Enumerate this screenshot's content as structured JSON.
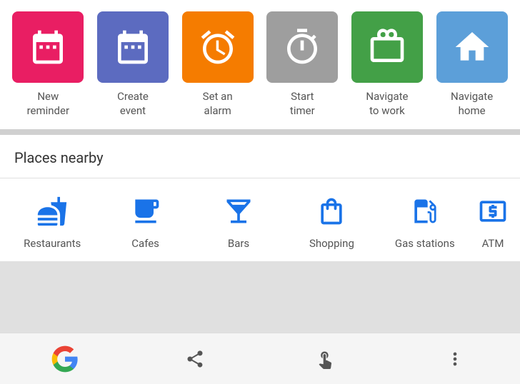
{
  "quick_actions": {
    "items": [
      {
        "id": "new-reminder",
        "label": "New\nreminder",
        "label_line1": "New",
        "label_line2": "reminder",
        "bg": "bg-pink",
        "icon": "reminder"
      },
      {
        "id": "create-event",
        "label": "Create\nevent",
        "label_line1": "Create",
        "label_line2": "event",
        "bg": "bg-purple",
        "icon": "calendar"
      },
      {
        "id": "set-alarm",
        "label": "Set an\nalarm",
        "label_line1": "Set an",
        "label_line2": "alarm",
        "bg": "bg-orange",
        "icon": "alarm"
      },
      {
        "id": "start-timer",
        "label": "Start\ntimer",
        "label_line1": "Start",
        "label_line2": "timer",
        "bg": "bg-gray",
        "icon": "timer"
      },
      {
        "id": "navigate-work",
        "label": "Navigate\nto work",
        "label_line1": "Navigate",
        "label_line2": "to work",
        "bg": "bg-green",
        "icon": "work"
      },
      {
        "id": "navigate-home",
        "label": "Navigate\nhome",
        "label_line1": "Navigate",
        "label_line2": "home",
        "bg": "bg-blue",
        "icon": "home"
      }
    ]
  },
  "places_nearby": {
    "title": "Places nearby",
    "items": [
      {
        "id": "restaurants",
        "label": "Restaurants",
        "icon": "cutlery"
      },
      {
        "id": "cafes",
        "label": "Cafes",
        "icon": "coffee"
      },
      {
        "id": "bars",
        "label": "Bars",
        "icon": "cocktail"
      },
      {
        "id": "shopping",
        "label": "Shopping",
        "icon": "shopping"
      },
      {
        "id": "gas-stations",
        "label": "Gas stations",
        "icon": "gas"
      },
      {
        "id": "atm",
        "label": "ATM",
        "icon": "atm"
      }
    ]
  },
  "bottom_nav": {
    "items": [
      {
        "id": "google",
        "icon": "google-g"
      },
      {
        "id": "share",
        "icon": "share"
      },
      {
        "id": "touch",
        "icon": "touch"
      },
      {
        "id": "more",
        "icon": "more-vertical"
      }
    ]
  }
}
